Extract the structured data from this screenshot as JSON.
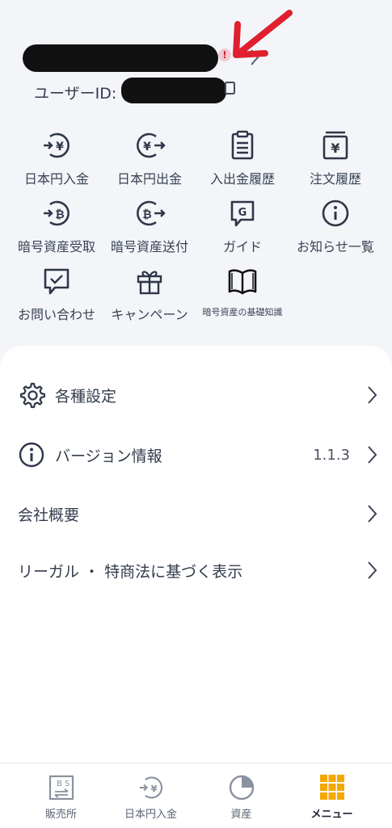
{
  "profile": {
    "user_id_label": "ユーザーID:",
    "alert_mark": "!"
  },
  "grid_items": [
    {
      "label": "日本円入金",
      "icon": "yen-deposit-icon"
    },
    {
      "label": "日本円出金",
      "icon": "yen-withdraw-icon"
    },
    {
      "label": "入出金履歴",
      "icon": "history-icon"
    },
    {
      "label": "注文履歴",
      "icon": "order-history-icon"
    },
    {
      "label": "暗号資産受取",
      "icon": "crypto-receive-icon"
    },
    {
      "label": "暗号資産送付",
      "icon": "crypto-send-icon"
    },
    {
      "label": "ガイド",
      "icon": "guide-icon"
    },
    {
      "label": "お知らせ一覧",
      "icon": "info-icon"
    },
    {
      "label": "お問い合わせ",
      "icon": "chat-check-icon"
    },
    {
      "label": "キャンペーン",
      "icon": "gift-icon"
    },
    {
      "label": "暗号資産の基礎知識",
      "icon": "book-icon"
    }
  ],
  "menu": {
    "settings": "各種設定",
    "version": "バージョン情報",
    "version_value": "1.1.3",
    "company": "会社概要",
    "legal": "リーガル ・ 特商法に基づく表示"
  },
  "tabs": [
    {
      "label": "販売所",
      "icon": "exchange-icon"
    },
    {
      "label": "日本円入金",
      "icon": "yen-deposit-icon"
    },
    {
      "label": "資産",
      "icon": "pie-chart-icon"
    },
    {
      "label": "メニュー",
      "icon": "menu-grid-icon",
      "active": true
    }
  ],
  "colors": {
    "annotation_red": "#e0202f",
    "active_tab": "#f5a800",
    "text": "#333c4e"
  }
}
